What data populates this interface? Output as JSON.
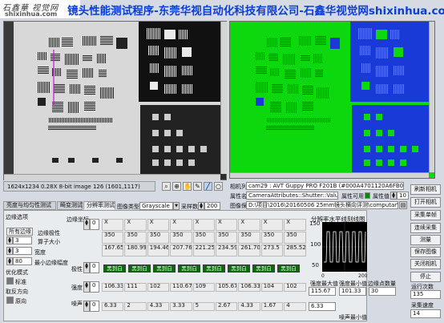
{
  "logo": {
    "line1": "石鑫華 视觉网",
    "line2": "shixinhua.com"
  },
  "title": "镜头性能测试程序-东莞华视自动化科技有限公司-石鑫华视觉网shixinhua.com",
  "left_status": "1624x1234 0.28X 8-bit image 126    (1601,1117)",
  "tools": [
    "zoom-icon",
    "search-icon",
    "hand-icon",
    "pen-icon",
    "rectangle-icon",
    "circle-icon"
  ],
  "camera": {
    "list_label": "相机列表",
    "list_value": "cam29 : AVT Guppy PRO F201B (#000A4701120A6FB0).icd",
    "prop_label": "属性名称",
    "prop_value": "CameraAttributes::Shutter::Value",
    "save_label": "图像保存",
    "save_path": "D:\\项目\\2016\\20160506 25mm镜头横向评测\\computar\\",
    "prop_enable": "属性可用",
    "prop_value_label": "属性值",
    "prop_num": "10"
  },
  "right_buttons": [
    "刷新相机",
    "打开相机",
    "采集单帧",
    "连续采集",
    "测量",
    "保存图像",
    "关闭相机",
    "停止"
  ],
  "run_count_label": "运行次数",
  "run_count": "135",
  "speed_label": "采集速度",
  "speed": "14",
  "tabs": [
    "亮度与均匀性测试",
    "畸变测试",
    "分辨率测试"
  ],
  "image_type_label": "图像类型",
  "image_type": "Grayscale",
  "sample_label": "采样数量",
  "sample_count": "200",
  "edge": {
    "title": "边缘选项",
    "mode": "所有边缘",
    "polarity_label": "边缘极性",
    "operator_label": "算子大小",
    "operator": "3",
    "width_label": "宽度",
    "width": "3",
    "min_label": "最小边缘幅度",
    "min": "80",
    "opt_label": "优化模式",
    "opt_value": "标准",
    "take_label": "取反方向",
    "take_value": "原向"
  },
  "table": {
    "edge_label": "边缘坐标",
    "polarity_label": "极性",
    "contrast_label": "强度",
    "noise_label": "噪声",
    "coord_row1": [
      "X",
      "X",
      "X",
      "X",
      "X",
      "X",
      "X",
      "X",
      "X"
    ],
    "coord_row2": [
      "350",
      "350",
      "350",
      "350",
      "350",
      "350",
      "350",
      "350",
      "350"
    ],
    "coord_row3": [
      "167.65",
      "180.99",
      "194.46",
      "207.76",
      "221.25",
      "234.59",
      "261.70",
      "273.5",
      "285.52"
    ],
    "polarity": [
      "黑到白",
      "黑到白",
      "黑到白",
      "黑到白",
      "黑到白",
      "黑到白",
      "黑到白",
      "黑到白"
    ],
    "contrast": [
      "106.33",
      "111",
      "102",
      "110.67",
      "109",
      "105.67",
      "106.33",
      "104",
      "102"
    ],
    "noise": [
      "6.33",
      "2",
      "4.33",
      "3.33",
      "5",
      "2.67",
      "4.33",
      "1.67",
      "4"
    ],
    "index_edge": "0",
    "index_pol": "0",
    "index_con": "0",
    "index_noise": "0"
  },
  "chart": {
    "title": "分辨率水平线刻线图",
    "y_max": "150",
    "y_mid": "100",
    "y_min": "50",
    "x_max": "200",
    "x_min": "0"
  },
  "stats": {
    "max_label": "强度最大值",
    "max": "115.67",
    "min_label": "强度最小值",
    "min": "101.33",
    "count_label": "边缘点数量",
    "count": "30",
    "noise_min_label": "噪声最小值",
    "noise_min": "6.33"
  }
}
